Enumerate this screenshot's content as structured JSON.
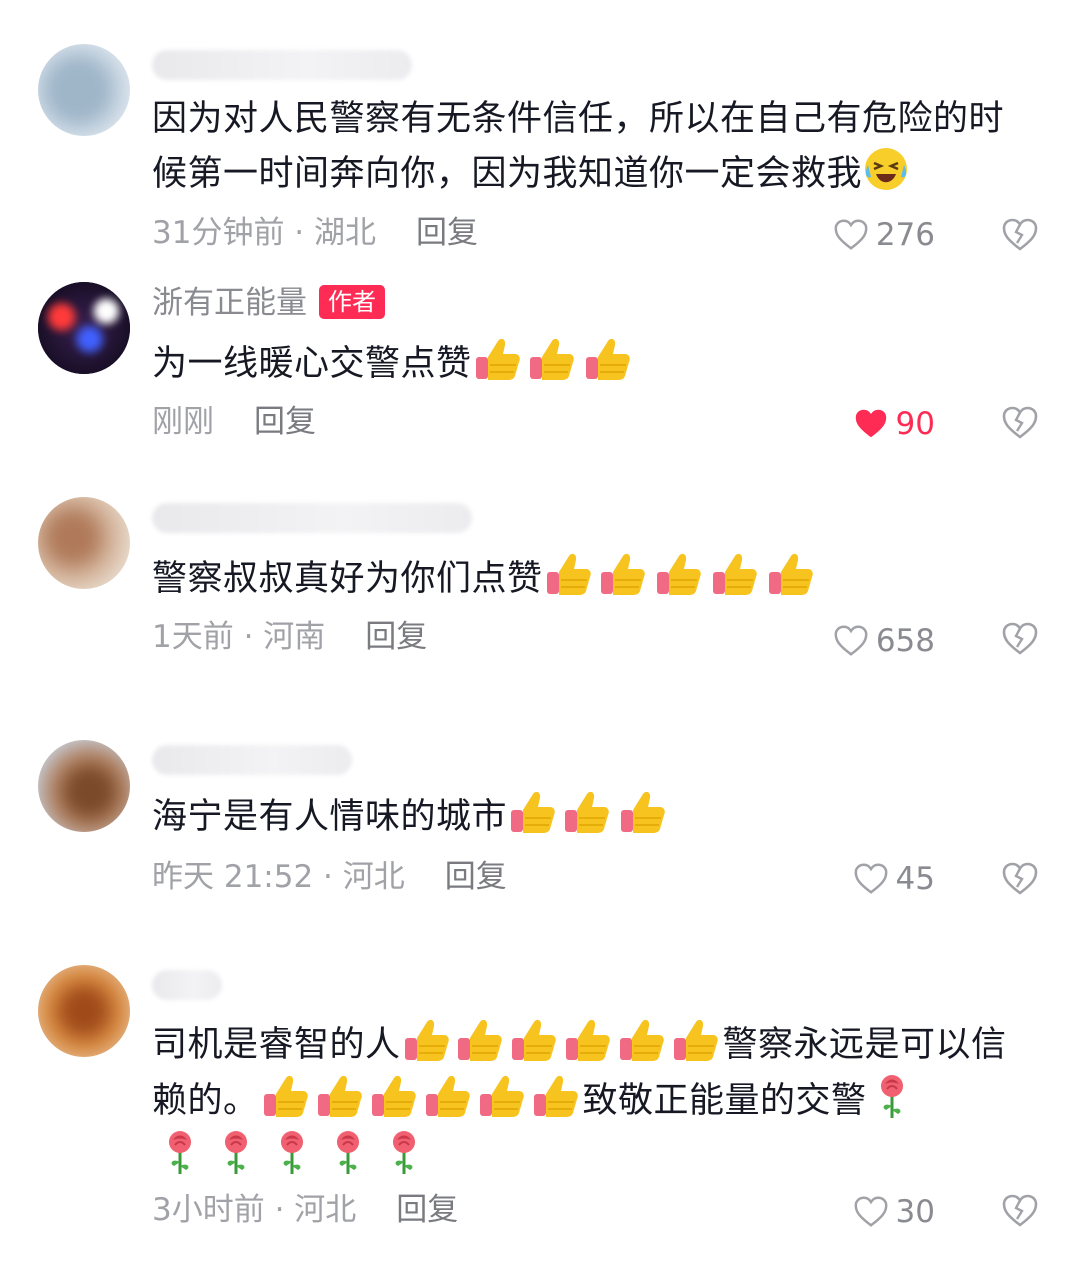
{
  "reply_label": "回复",
  "colors": {
    "accent": "#fe2c55",
    "text": "#161823",
    "meta": "#a1a2a7"
  },
  "comments": [
    {
      "content": "因为对人民警察有无条件信任，所以在自己有危险的时候第一时间奔向你，因为我知道你一定会救我",
      "emoji": "laughing-tears-emoji",
      "time_location": "31分钟前 · 湖北",
      "likes": "276",
      "liked": false
    },
    {
      "username": "浙有正能量",
      "author_badge": "作者",
      "content": "为一线暖心交警点赞",
      "emoji": "thumbs-up-emoji x3",
      "time_location": "刚刚",
      "likes": "90",
      "liked": true
    },
    {
      "content": "警察叔叔真好为你们点赞",
      "emoji": "thumbs-up-emoji x5",
      "time_location": "1天前 · 河南",
      "likes": "658",
      "liked": false
    },
    {
      "content": "海宁是有人情味的城市",
      "emoji": "thumbs-up-emoji x3",
      "time_location": "昨天 21:52 · 河北",
      "likes": "45",
      "liked": false
    },
    {
      "content_a": "司机是睿智的人",
      "content_b": "警察永远是可以信赖的。",
      "content_c": "致敬正能量的交警",
      "emoji": "thumbs-up-emoji x12, rose-emoji x6",
      "time_location": "3小时前 · 河北",
      "likes": "30",
      "liked": false
    }
  ]
}
